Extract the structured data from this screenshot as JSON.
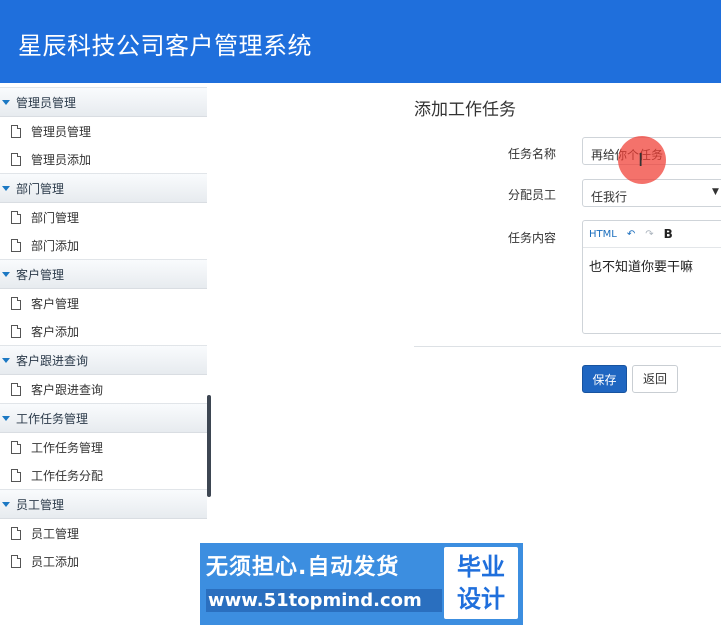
{
  "header": {
    "title": "星辰科技公司客户管理系统"
  },
  "sidebar": {
    "groups": [
      {
        "label": "管理员管理",
        "items": [
          "管理员管理",
          "管理员添加"
        ]
      },
      {
        "label": "部门管理",
        "items": [
          "部门管理",
          "部门添加"
        ]
      },
      {
        "label": "客户管理",
        "items": [
          "客户管理",
          "客户添加"
        ]
      },
      {
        "label": "客户跟进查询",
        "items": [
          "客户跟进查询"
        ]
      },
      {
        "label": "工作任务管理",
        "items": [
          "工作任务管理",
          "工作任务分配"
        ]
      },
      {
        "label": "员工管理",
        "items": [
          "员工管理",
          "员工添加"
        ]
      }
    ]
  },
  "form": {
    "title": "添加工作任务",
    "task_name_label": "任务名称",
    "task_name_value": "再给你个任务",
    "assignee_label": "分配员工",
    "assignee_value": "任我行",
    "content_label": "任务内容",
    "content_value": "也不知道你要干嘛",
    "toolbar": {
      "html": "HTML",
      "bold": "B"
    },
    "save_label": "保存",
    "back_label": "返回"
  },
  "banner": {
    "line1": "无须担心.自动发货",
    "line2": "www.51topmind.com",
    "right1": "毕业",
    "right2": "设计"
  },
  "colors": {
    "header": "#1f6fdc",
    "primary_button": "#1f66c1",
    "cursor_highlight": "#f03c32"
  }
}
